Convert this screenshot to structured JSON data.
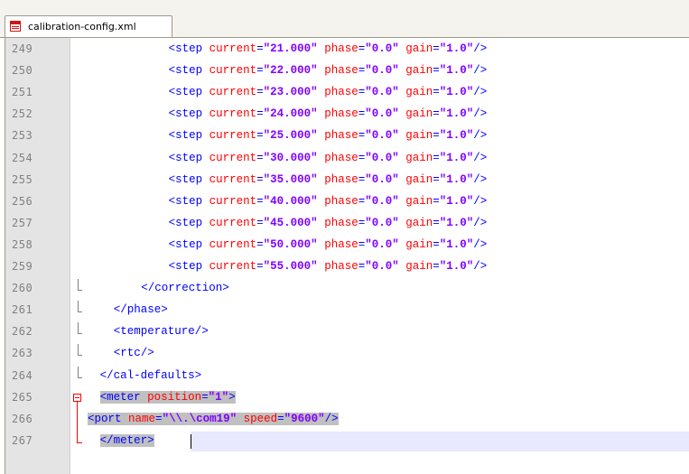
{
  "tab": {
    "filename": "calibration-config.xml",
    "icon": "xml-file-icon"
  },
  "colors": {
    "tag": "#0000ff",
    "attr_name": "#ff0000",
    "attr_value": "#8000ff",
    "selection": "#c0c0c0",
    "fold_marker": "#ff0000",
    "line_number": "#808080"
  },
  "lines": [
    {
      "num": "249",
      "indent": 11,
      "tag_open": "<step",
      "attrs": [
        [
          "current",
          "\"21.000\""
        ],
        [
          "phase",
          "\"0.0\""
        ],
        [
          "gain",
          "\"1.0\""
        ]
      ],
      "tag_close": "/>"
    },
    {
      "num": "250",
      "indent": 11,
      "tag_open": "<step",
      "attrs": [
        [
          "current",
          "\"22.000\""
        ],
        [
          "phase",
          "\"0.0\""
        ],
        [
          "gain",
          "\"1.0\""
        ]
      ],
      "tag_close": "/>"
    },
    {
      "num": "251",
      "indent": 11,
      "tag_open": "<step",
      "attrs": [
        [
          "current",
          "\"23.000\""
        ],
        [
          "phase",
          "\"0.0\""
        ],
        [
          "gain",
          "\"1.0\""
        ]
      ],
      "tag_close": "/>"
    },
    {
      "num": "252",
      "indent": 11,
      "tag_open": "<step",
      "attrs": [
        [
          "current",
          "\"24.000\""
        ],
        [
          "phase",
          "\"0.0\""
        ],
        [
          "gain",
          "\"1.0\""
        ]
      ],
      "tag_close": "/>"
    },
    {
      "num": "253",
      "indent": 11,
      "tag_open": "<step",
      "attrs": [
        [
          "current",
          "\"25.000\""
        ],
        [
          "phase",
          "\"0.0\""
        ],
        [
          "gain",
          "\"1.0\""
        ]
      ],
      "tag_close": "/>"
    },
    {
      "num": "254",
      "indent": 11,
      "tag_open": "<step",
      "attrs": [
        [
          "current",
          "\"30.000\""
        ],
        [
          "phase",
          "\"0.0\""
        ],
        [
          "gain",
          "\"1.0\""
        ]
      ],
      "tag_close": "/>"
    },
    {
      "num": "255",
      "indent": 11,
      "tag_open": "<step",
      "attrs": [
        [
          "current",
          "\"35.000\""
        ],
        [
          "phase",
          "\"0.0\""
        ],
        [
          "gain",
          "\"1.0\""
        ]
      ],
      "tag_close": "/>"
    },
    {
      "num": "256",
      "indent": 11,
      "tag_open": "<step",
      "attrs": [
        [
          "current",
          "\"40.000\""
        ],
        [
          "phase",
          "\"0.0\""
        ],
        [
          "gain",
          "\"1.0\""
        ]
      ],
      "tag_close": "/>"
    },
    {
      "num": "257",
      "indent": 11,
      "tag_open": "<step",
      "attrs": [
        [
          "current",
          "\"45.000\""
        ],
        [
          "phase",
          "\"0.0\""
        ],
        [
          "gain",
          "\"1.0\""
        ]
      ],
      "tag_close": "/>"
    },
    {
      "num": "258",
      "indent": 11,
      "tag_open": "<step",
      "attrs": [
        [
          "current",
          "\"50.000\""
        ],
        [
          "phase",
          "\"0.0\""
        ],
        [
          "gain",
          "\"1.0\""
        ]
      ],
      "tag_close": "/>"
    },
    {
      "num": "259",
      "indent": 11,
      "tag_open": "<step",
      "attrs": [
        [
          "current",
          "\"55.000\""
        ],
        [
          "phase",
          "\"0.0\""
        ],
        [
          "gain",
          "\"1.0\""
        ]
      ],
      "tag_close": "/>"
    },
    {
      "num": "260",
      "indent": 7,
      "tag_open": "</correction>",
      "attrs": [],
      "tag_close": ""
    },
    {
      "num": "261",
      "indent": 3,
      "tag_open": "</phase>",
      "attrs": [],
      "tag_close": ""
    },
    {
      "num": "262",
      "indent": 3,
      "tag_open": "<temperature/>",
      "attrs": [],
      "tag_close": ""
    },
    {
      "num": "263",
      "indent": 3,
      "tag_open": "<rtc/>",
      "attrs": [],
      "tag_close": ""
    },
    {
      "num": "264",
      "indent": 1,
      "tag_open": "</cal-defaults>",
      "attrs": [],
      "tag_close": ""
    },
    {
      "num": "265",
      "indent": 1,
      "tag_open": "<meter",
      "attrs": [
        [
          "position",
          "\"1\""
        ]
      ],
      "tag_close": ">"
    },
    {
      "num": "266",
      "indent": 0,
      "tag_open": "<port",
      "attrs": [
        [
          "name",
          "\"\\\\.\\com19\""
        ],
        [
          "speed",
          "\"9600\""
        ]
      ],
      "tag_close": "/>"
    },
    {
      "num": "267",
      "indent": 1,
      "tag_open": "</meter>",
      "attrs": [],
      "tag_close": ""
    }
  ]
}
